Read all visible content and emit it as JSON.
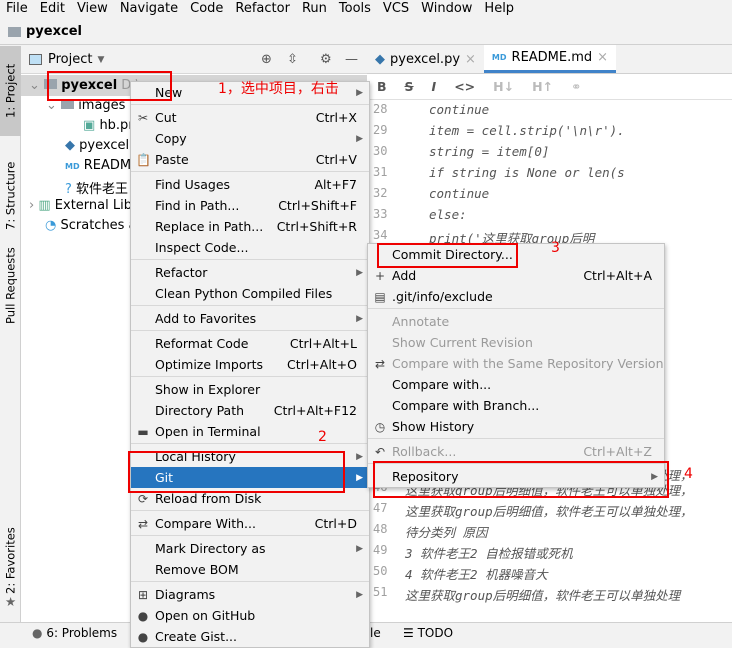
{
  "menubar": [
    "File",
    "Edit",
    "View",
    "Navigate",
    "Code",
    "Refactor",
    "Run",
    "Tools",
    "VCS",
    "Window",
    "Help"
  ],
  "nav": {
    "project": "pyexcel"
  },
  "left_tabs": {
    "project": "1: Project",
    "structure": "7: Structure",
    "pull": "Pull Requests",
    "favorites": "2: Favorites"
  },
  "project_panel": {
    "title": "Project",
    "tree": {
      "root": "pyexcel",
      "root_path": "D:\\",
      "images": "images",
      "hb": "hb.pr",
      "pyexcel_py": "pyexcel.p",
      "readme": "README",
      "laowang": "软件老王",
      "external": "External Lib",
      "scratches": "Scratches a"
    }
  },
  "editor": {
    "tabs": [
      "pyexcel.py",
      "README.md"
    ],
    "md_toolbar": [
      "B",
      "S",
      "I",
      "<>",
      "H↓",
      "H↑",
      "link"
    ],
    "lines_top": [
      {
        "n": "28",
        "code": "        continue"
      },
      {
        "n": "29",
        "code": "    item = cell.strip('\\n\\r')."
      },
      {
        "n": "30",
        "code": "    string = item[0]"
      },
      {
        "n": "31",
        "code": "    if string is None or len(s"
      },
      {
        "n": "32",
        "code": "        continue"
      },
      {
        "n": "33",
        "code": "    else:"
      },
      {
        "n": "34",
        "code": "        print('这里获取group后明"
      }
    ],
    "lines_bottom": [
      {
        "n": "46",
        "code": "这里获取group后明细值，软件老王可以单独处理，"
      },
      {
        "n": "47",
        "code": "这里获取group后明细值，软件老王可以单独处理，"
      },
      {
        "n": "48",
        "code": "    待分类列        原因"
      },
      {
        "n": "49",
        "code": "3   软件老王2   自检报错或死机"
      },
      {
        "n": "50",
        "code": "4   软件老王2     机器噪音大"
      },
      {
        "n": "51",
        "code": "这里获取group后明细值，软件老王可以单独处理"
      }
    ],
    "line45_tail": "单独处理，"
  },
  "context_menu": [
    {
      "label": "New",
      "arrow": true
    },
    "sep",
    {
      "label": "Cut",
      "shortcut": "Ctrl+X",
      "icon": "✂"
    },
    {
      "label": "Copy",
      "arrow": true
    },
    {
      "label": "Paste",
      "shortcut": "Ctrl+V",
      "icon": "📋"
    },
    "sep",
    {
      "label": "Find Usages",
      "shortcut": "Alt+F7"
    },
    {
      "label": "Find in Path...",
      "shortcut": "Ctrl+Shift+F"
    },
    {
      "label": "Replace in Path...",
      "shortcut": "Ctrl+Shift+R"
    },
    {
      "label": "Inspect Code..."
    },
    "sep",
    {
      "label": "Refactor",
      "arrow": true
    },
    {
      "label": "Clean Python Compiled Files"
    },
    "sep",
    {
      "label": "Add to Favorites",
      "arrow": true
    },
    "sep",
    {
      "label": "Reformat Code",
      "shortcut": "Ctrl+Alt+L"
    },
    {
      "label": "Optimize Imports",
      "shortcut": "Ctrl+Alt+O"
    },
    "sep",
    {
      "label": "Show in Explorer"
    },
    {
      "label": "Directory Path",
      "shortcut": "Ctrl+Alt+F12"
    },
    {
      "label": "Open in Terminal",
      "icon": "▬"
    },
    "sep",
    {
      "label": "Local History",
      "arrow": true
    },
    {
      "label": "Git",
      "arrow": true,
      "selected": true
    },
    {
      "label": "Reload from Disk",
      "icon": "⟳"
    },
    "sep",
    {
      "label": "Compare With...",
      "shortcut": "Ctrl+D",
      "icon": "⇄"
    },
    "sep",
    {
      "label": "Mark Directory as",
      "arrow": true
    },
    {
      "label": "Remove BOM"
    },
    "sep",
    {
      "label": "Diagrams",
      "arrow": true,
      "icon": "⊞"
    },
    {
      "label": "Open on GitHub",
      "icon": "●"
    },
    {
      "label": "Create Gist...",
      "icon": "●"
    }
  ],
  "git_submenu": [
    {
      "label": "Commit Directory..."
    },
    {
      "label": "Add",
      "shortcut": "Ctrl+Alt+A",
      "icon": "+"
    },
    {
      "label": ".git/info/exclude",
      "icon": "▤"
    },
    "sep",
    {
      "label": "Annotate",
      "disabled": true
    },
    {
      "label": "Show Current Revision",
      "disabled": true
    },
    {
      "label": "Compare with the Same Repository Version",
      "disabled": true,
      "icon": "⇄"
    },
    {
      "label": "Compare with..."
    },
    {
      "label": "Compare with Branch..."
    },
    {
      "label": "Show History",
      "icon": "◷"
    },
    "sep",
    {
      "label": "Rollback...",
      "shortcut": "Ctrl+Alt+Z",
      "disabled": true,
      "icon": "↶"
    },
    "sep",
    {
      "label": "Repository",
      "arrow": true
    }
  ],
  "annotations": {
    "step1": "1，选中项目，右击",
    "step2": "2",
    "step3": "3",
    "step4": "4"
  },
  "bottom": {
    "problems": "6: Problems",
    "terminal_tail": "le",
    "todo": "TODO"
  },
  "colors": {
    "selection": "#2675bf",
    "annotation": "#e00000",
    "tab_accent": "#4083c9"
  }
}
